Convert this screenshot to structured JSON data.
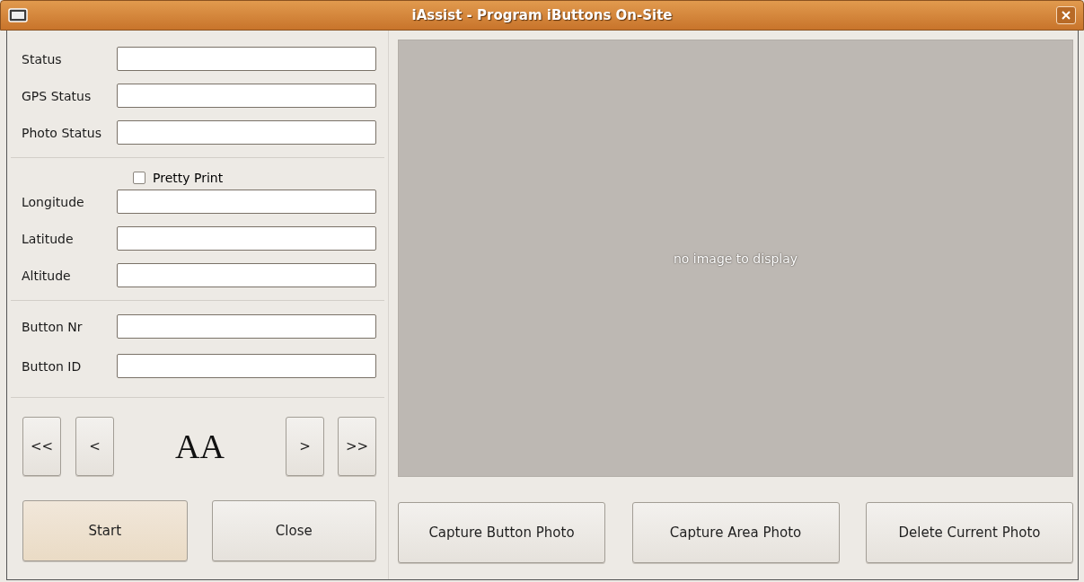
{
  "window": {
    "title": "iAssist - Program iButtons On-Site"
  },
  "status_section": {
    "fields": [
      {
        "label": "Status"
      },
      {
        "label": "GPS Status"
      },
      {
        "label": "Photo Status"
      }
    ]
  },
  "position_section": {
    "pretty_print": {
      "label": "Pretty Print",
      "checked": false
    },
    "fields": [
      {
        "label": "Longitude"
      },
      {
        "label": "Latitude"
      },
      {
        "label": "Altitude"
      }
    ]
  },
  "button_section": {
    "fields": [
      {
        "label": "Button Nr"
      },
      {
        "label": "Button ID"
      }
    ]
  },
  "navigation": {
    "buttons_left": [
      "<<",
      "<"
    ],
    "display": "AA",
    "buttons_right": [
      ">",
      ">>"
    ]
  },
  "actions": [
    {
      "label": "Start",
      "selected": true
    },
    {
      "label": "Close",
      "selected": false
    }
  ],
  "image_view": {
    "message": "no image to display"
  },
  "photo_buttons": [
    "Capture Button Photo",
    "Capture Area Photo",
    "Delete Current Photo"
  ]
}
